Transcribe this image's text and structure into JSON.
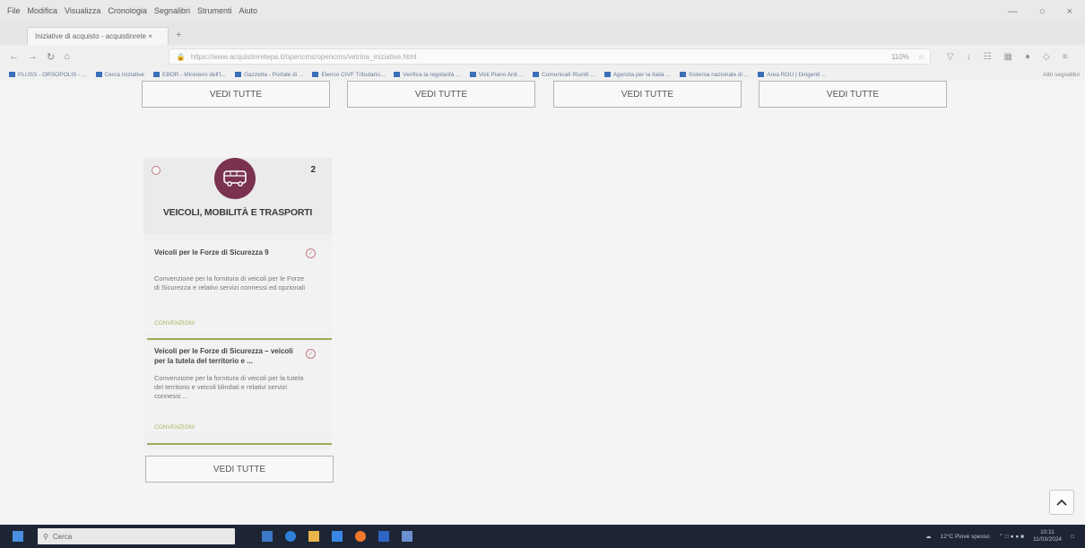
{
  "browser": {
    "menu": [
      "File",
      "Modifica",
      "Visualizza",
      "Cronologia",
      "Segnalibri",
      "Strumenti",
      "Aiuto"
    ],
    "tab_title": "Iniziative di acquisto - acquistinrete ×",
    "url": "https://www.acquistinretepa.it/opencms/opencms/vetrina_iniziative.html",
    "zoom": "110%",
    "bookmarks": [
      "PLUSS - ORSOPOLIS - ...",
      "Cerca Iniziative",
      "EBOR - Ministero dell'I...",
      "Gazzetta - Portale di ...",
      "Elenco CIVF Tributario...",
      "Verifica la regolarità ...",
      "Visti Piano Anti ...",
      "Comunicati Riuniti ...",
      "Agenzia per la Italia ...",
      "Sistema nazionale di ...",
      "Area ROU | Dirigenti ..."
    ],
    "bookmarks_other": "Altri segnalibri"
  },
  "content": {
    "top_buttons": [
      "VEDI TUTTE",
      "VEDI TUTTE",
      "VEDI TUTTE",
      "VEDI TUTTE"
    ],
    "card": {
      "count": "2",
      "title": "VEICOLI, MOBILITÀ E TRASPORTI",
      "icon": "bus-icon",
      "items": [
        {
          "title": "Veicoli per le Forze di Sicurezza 9",
          "description": "Convenzione per la fornitura di veicoli per le Forze di Sicurezza e relativi servizi connessi ed opzionali",
          "type": "CONVENZIONI"
        },
        {
          "title": "Veicoli per le Forze di Sicurezza – veicoli per la tutela del territorio e ...",
          "description": "Convenzione per la fornitura di veicoli per la tutela del territorio e veicoli blindati e relativi servizi connessi ...",
          "type": "CONVENZIONI"
        }
      ],
      "button": "VEDI TUTTE"
    },
    "scroll_top_icon": "chevron-up-icon"
  },
  "taskbar": {
    "search_placeholder": "Cerca",
    "weather": "12°C Piove spesso",
    "time": "10:11",
    "date": "11/03/2024"
  },
  "colors": {
    "accent_plum": "#7a3250",
    "convenzione_green": "#9aab5a"
  }
}
